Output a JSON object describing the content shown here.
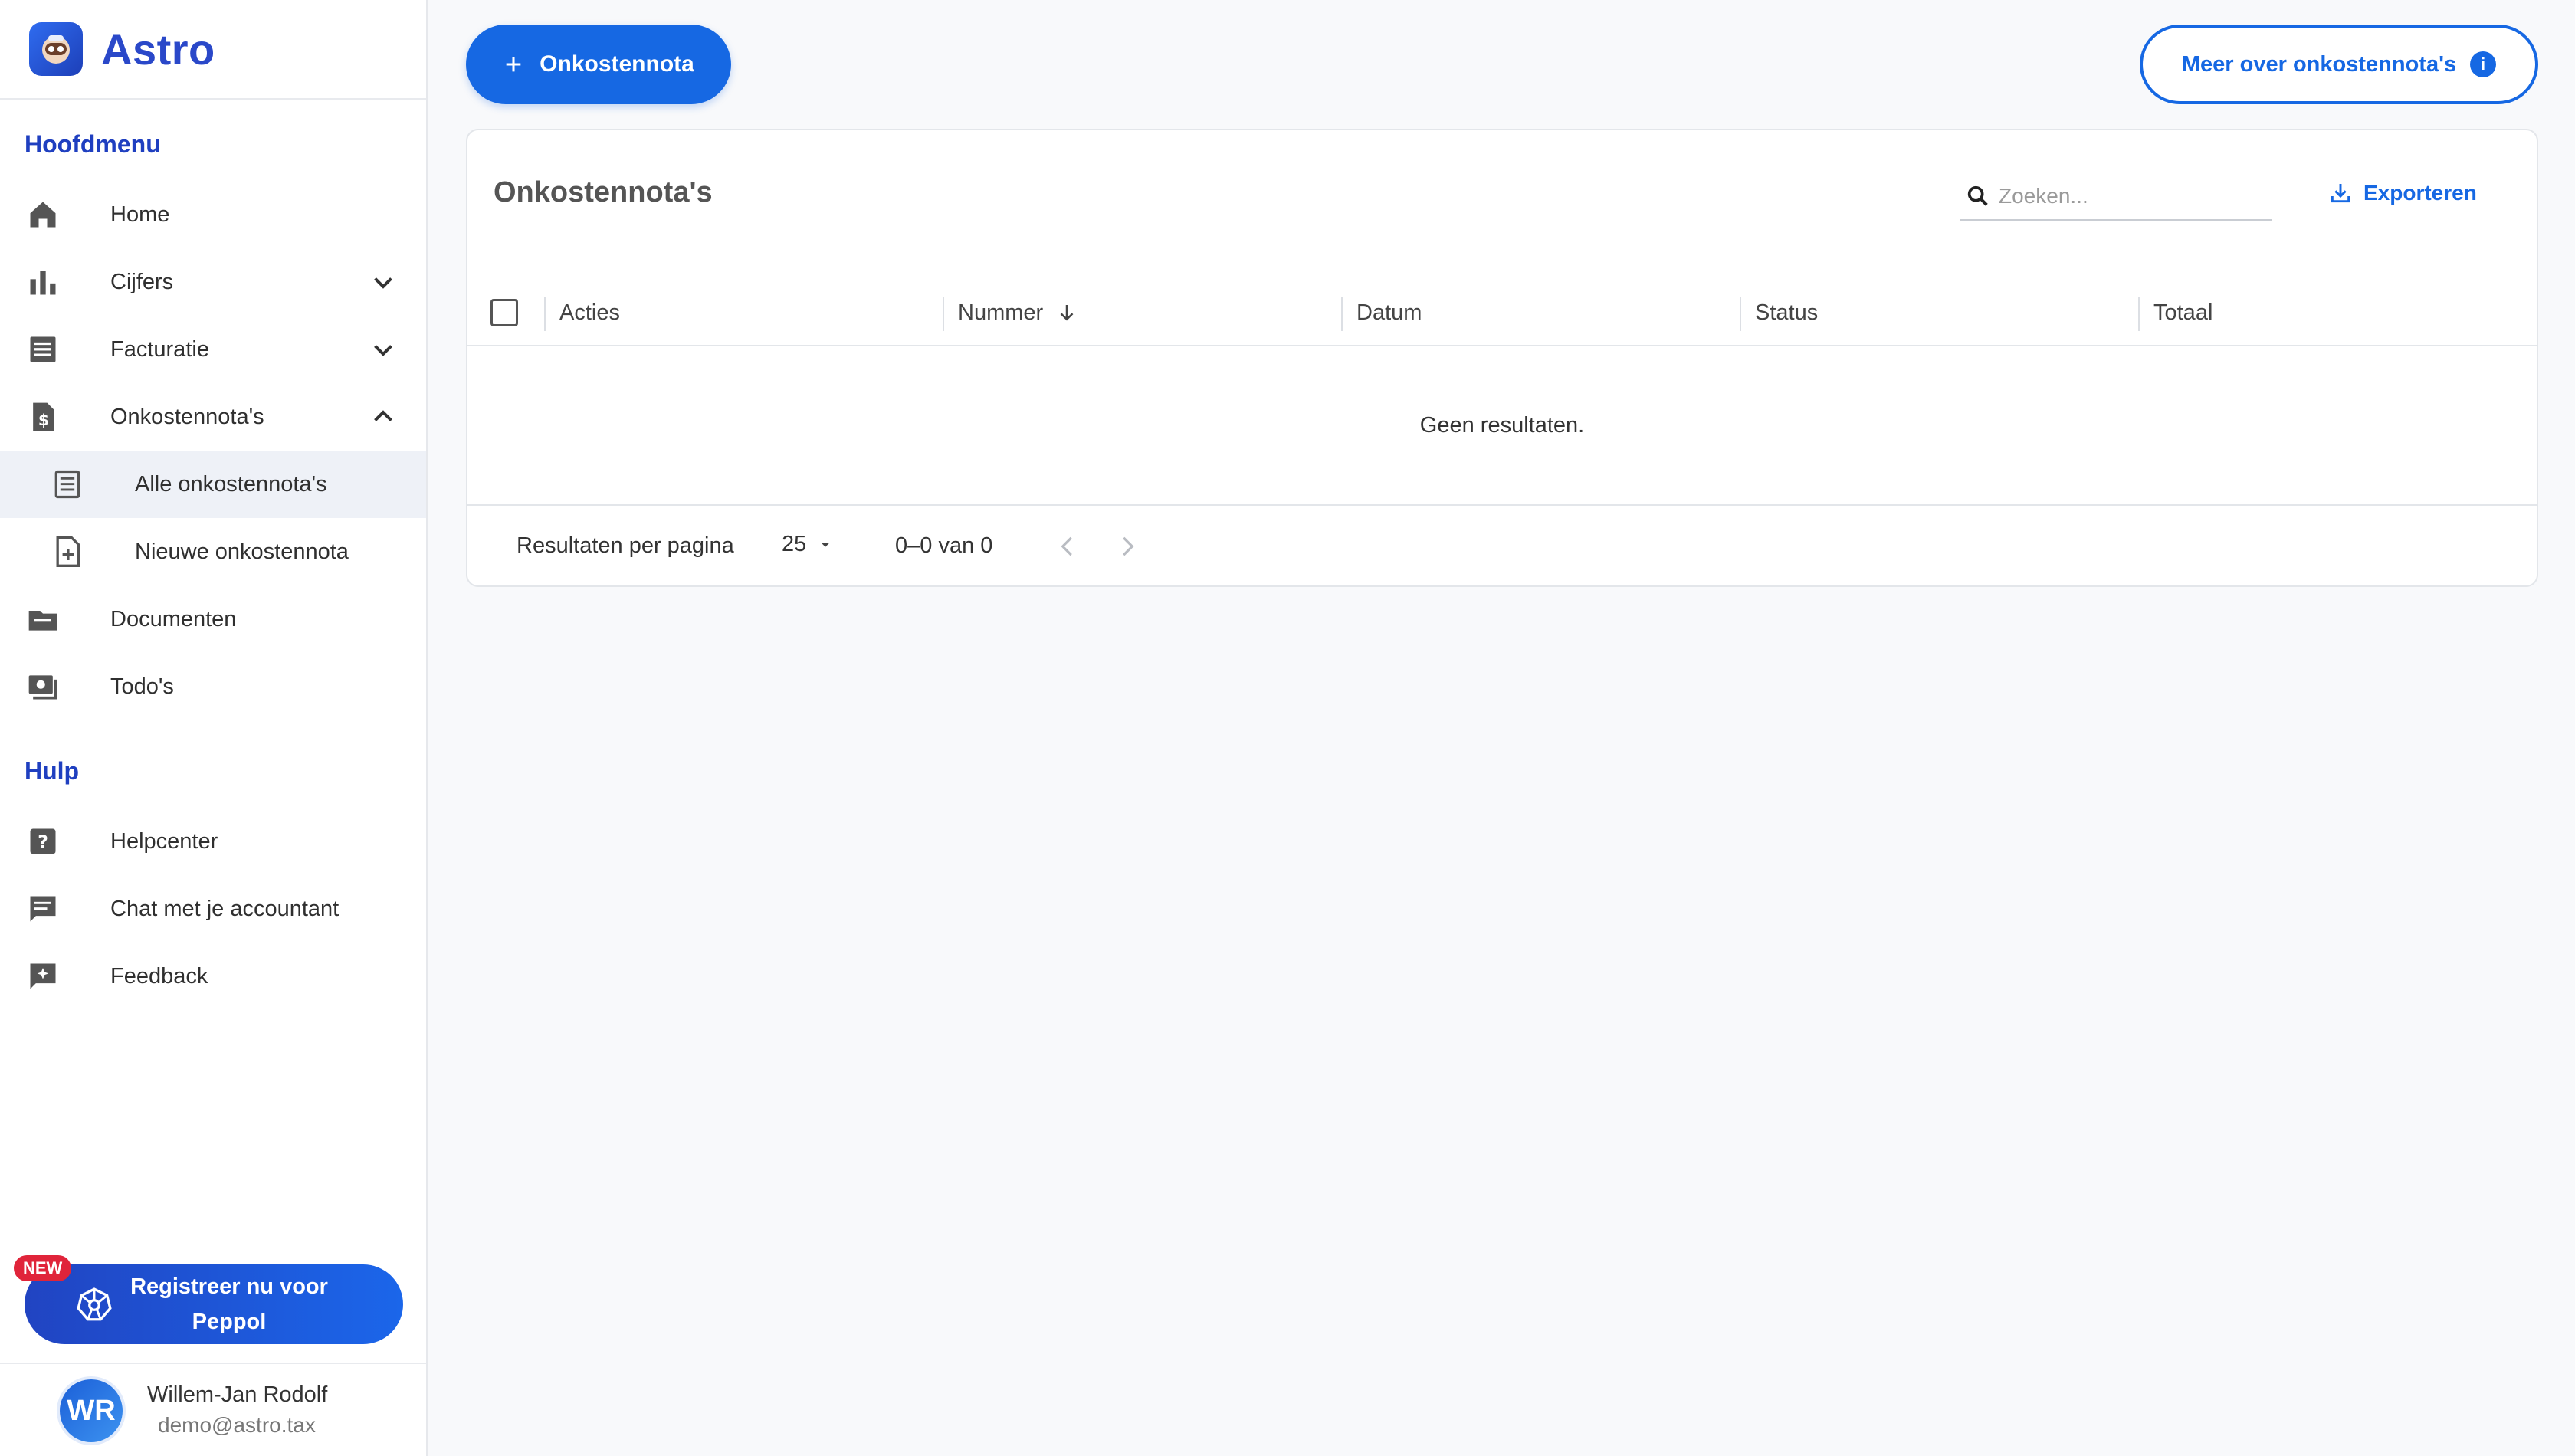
{
  "app": {
    "name": "Astro"
  },
  "colors": {
    "brand": "#2a48c9",
    "primary": "#1668e3",
    "badge": "#e0243a"
  },
  "sidebar": {
    "main_title": "Hoofdmenu",
    "items": [
      {
        "label": "Home",
        "icon": "home-icon"
      },
      {
        "label": "Cijfers",
        "icon": "bar-chart-icon"
      },
      {
        "label": "Facturatie",
        "icon": "invoice-icon"
      },
      {
        "label": "Onkostennota's",
        "icon": "receipt-dollar-icon"
      },
      {
        "label": "Alle onkostennota's",
        "icon": "receipt-list-icon"
      },
      {
        "label": "Nieuwe onkostennota",
        "icon": "file-plus-icon"
      },
      {
        "label": "Documenten",
        "icon": "folder-icon"
      },
      {
        "label": "Todo's",
        "icon": "todo-icon"
      }
    ],
    "help_title": "Hulp",
    "help_items": [
      {
        "label": "Helpcenter",
        "icon": "help-icon"
      },
      {
        "label": "Chat met je accountant",
        "icon": "chat-icon"
      },
      {
        "label": "Feedback",
        "icon": "feedback-icon"
      }
    ],
    "peppol": {
      "badge": "NEW",
      "label": "Registreer nu voor Peppol"
    },
    "user": {
      "initials": "WR",
      "name": "Willem-Jan Rodolf",
      "email": "demo@astro.tax"
    }
  },
  "toolbar": {
    "new_label": "Onkostennota",
    "info_label": "Meer over onkostennota's"
  },
  "card": {
    "title": "Onkostennota's",
    "search_placeholder": "Zoeken...",
    "export_label": "Exporteren",
    "columns": [
      "Acties",
      "Nummer",
      "Datum",
      "Status",
      "Totaal"
    ],
    "empty_text": "Geen resultaten.",
    "pagination": {
      "rows_label": "Resultaten per pagina",
      "page_size": "25",
      "range": "0–0 van 0"
    }
  }
}
